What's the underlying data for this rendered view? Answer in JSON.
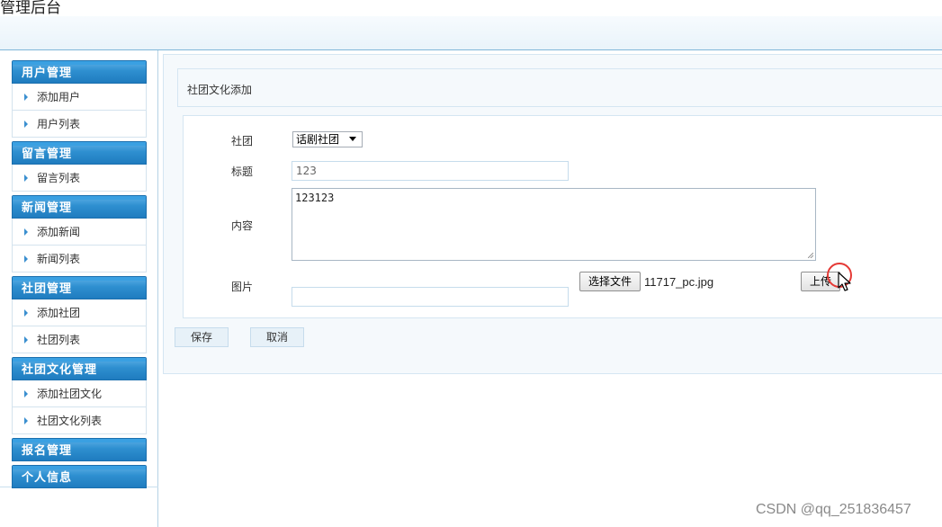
{
  "header": {
    "title": "管理后台"
  },
  "sidebar": {
    "groups": [
      {
        "label": "用户管理",
        "items": [
          "添加用户",
          "用户列表"
        ]
      },
      {
        "label": "留言管理",
        "items": [
          "留言列表"
        ]
      },
      {
        "label": "新闻管理",
        "items": [
          "添加新闻",
          "新闻列表"
        ]
      },
      {
        "label": "社团管理",
        "items": [
          "添加社团",
          "社团列表"
        ]
      },
      {
        "label": "社团文化管理",
        "items": [
          "添加社团文化",
          "社团文化列表"
        ]
      },
      {
        "label": "报名管理",
        "items": []
      },
      {
        "label": "个人信息",
        "items": []
      }
    ]
  },
  "main": {
    "section_title": "社团文化添加",
    "form": {
      "club_label": "社团",
      "club_selected": "话剧社团",
      "title_label": "标题",
      "title_value": "123",
      "content_label": "内容",
      "content_value": "123123",
      "image_label": "图片",
      "image_value": "",
      "choose_file_label": "选择文件",
      "file_name": "11717_pc.jpg",
      "upload_label": "上传"
    },
    "save_label": "保存",
    "cancel_label": "取消"
  },
  "watermark": "CSDN @qq_251836457",
  "colors": {
    "menu_head": "#2e8fd0",
    "panel_bg": "#f5f9fc",
    "border": "#d5e6f2",
    "click_indicator": "#e53935"
  }
}
